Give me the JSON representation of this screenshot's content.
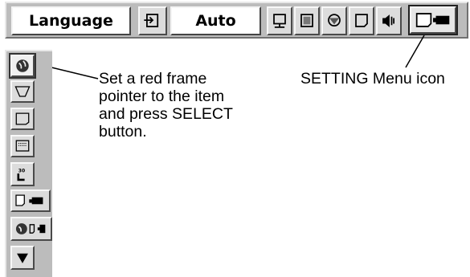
{
  "top_menu": {
    "language_label": "Language",
    "mode_value": "Auto",
    "icons": [
      "input-icon",
      "pc-adjust-icon",
      "image-select-icon",
      "image-adjust-icon",
      "screen-icon",
      "sound-icon",
      "setting-icon"
    ]
  },
  "sidebar": {
    "icons": [
      "language-icon",
      "keystone-icon",
      "blue-back-icon",
      "display-icon",
      "ceiling-icon",
      "rear-icon",
      "lamp-counter-reset-icon",
      "scroll-down-icon"
    ]
  },
  "callouts": {
    "instruction_lines": [
      "Set a red frame",
      "pointer to the item",
      "and press SELECT",
      "button."
    ],
    "setting_label": "SETTING Menu icon"
  }
}
